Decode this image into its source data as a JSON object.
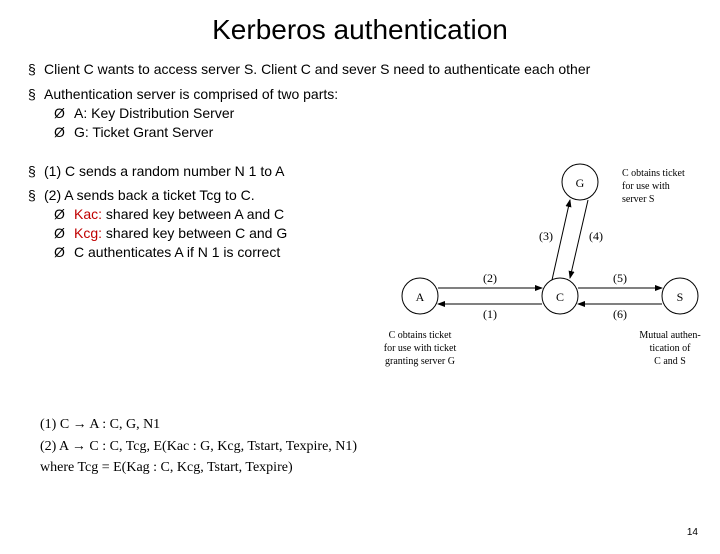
{
  "title": "Kerberos authentication",
  "bullets": {
    "b1": "Client C wants to access server S. Client C and sever S need to authenticate each other",
    "b2": "Authentication server is comprised of two parts:",
    "b2a": "A:   Key Distribution Server",
    "b2b": "G:  Ticket Grant Server",
    "b3": "(1) C sends a random number N 1 to A",
    "b4": "(2)  A sends back a ticket Tcg to C.",
    "b4a_key": "Kac:",
    "b4a_rest": " shared key between A and C",
    "b4b_key": "Kcg:",
    "b4b_rest": " shared key between C and G",
    "b4c": "C authenticates A if N 1 is correct"
  },
  "diagram": {
    "nodeA": "A",
    "nodeC": "C",
    "nodeG": "G",
    "nodeS": "S",
    "e1": "(1)",
    "e2": "(2)",
    "e3": "(3)",
    "e4": "(4)",
    "e5": "(5)",
    "e6": "(6)",
    "captionG1": "C obtains ticket",
    "captionG2": "for use with",
    "captionG3": "server S",
    "captionA1": "C obtains ticket",
    "captionA2": "for use with ticket",
    "captionA3": "granting server G",
    "captionS1": "Mutual authen-",
    "captionS2": "tication of",
    "captionS3": "C and S"
  },
  "protocol": {
    "l1": "(1)  C → A : C, G, N1",
    "l2": "(2)  A → C : C, Tcg, E(Kac : G, Kcg, Tstart, Texpire, N1)",
    "l3": "where  Tcg = E(Kag : C, Kcg, Tstart, Texpire)"
  },
  "page": "14"
}
